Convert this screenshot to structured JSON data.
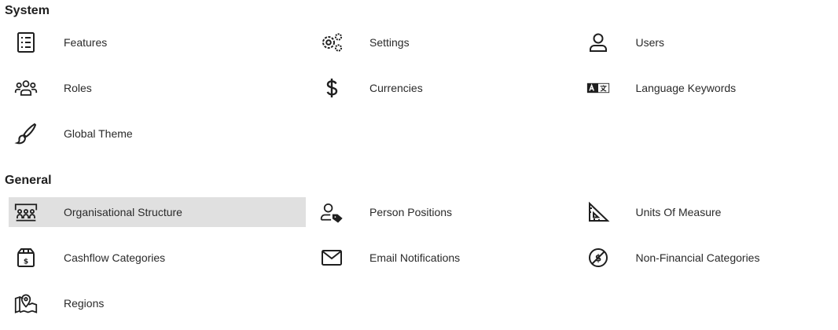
{
  "sections": {
    "system": {
      "title": "System",
      "items": [
        {
          "label": "Features",
          "icon": "checklist-icon"
        },
        {
          "label": "Settings",
          "icon": "gears-icon"
        },
        {
          "label": "Users",
          "icon": "user-icon"
        },
        {
          "label": "Roles",
          "icon": "group-icon"
        },
        {
          "label": "Currencies",
          "icon": "dollar-icon"
        },
        {
          "label": "Language Keywords",
          "icon": "translate-icon"
        },
        {
          "label": "Global Theme",
          "icon": "brush-icon"
        }
      ]
    },
    "general": {
      "title": "General",
      "items": [
        {
          "label": "Organisational Structure",
          "icon": "org-structure-icon",
          "selected": true
        },
        {
          "label": "Person Positions",
          "icon": "user-tag-icon"
        },
        {
          "label": "Units Of Measure",
          "icon": "set-square-icon"
        },
        {
          "label": "Cashflow Categories",
          "icon": "money-box-icon"
        },
        {
          "label": "Email Notifications",
          "icon": "envelope-icon"
        },
        {
          "label": "Non-Financial Categories",
          "icon": "no-money-icon"
        },
        {
          "label": "Regions",
          "icon": "map-pin-icon"
        }
      ]
    }
  },
  "colors": {
    "selected_bg": "#e0e0e0",
    "icon": "#1f1f1f"
  }
}
